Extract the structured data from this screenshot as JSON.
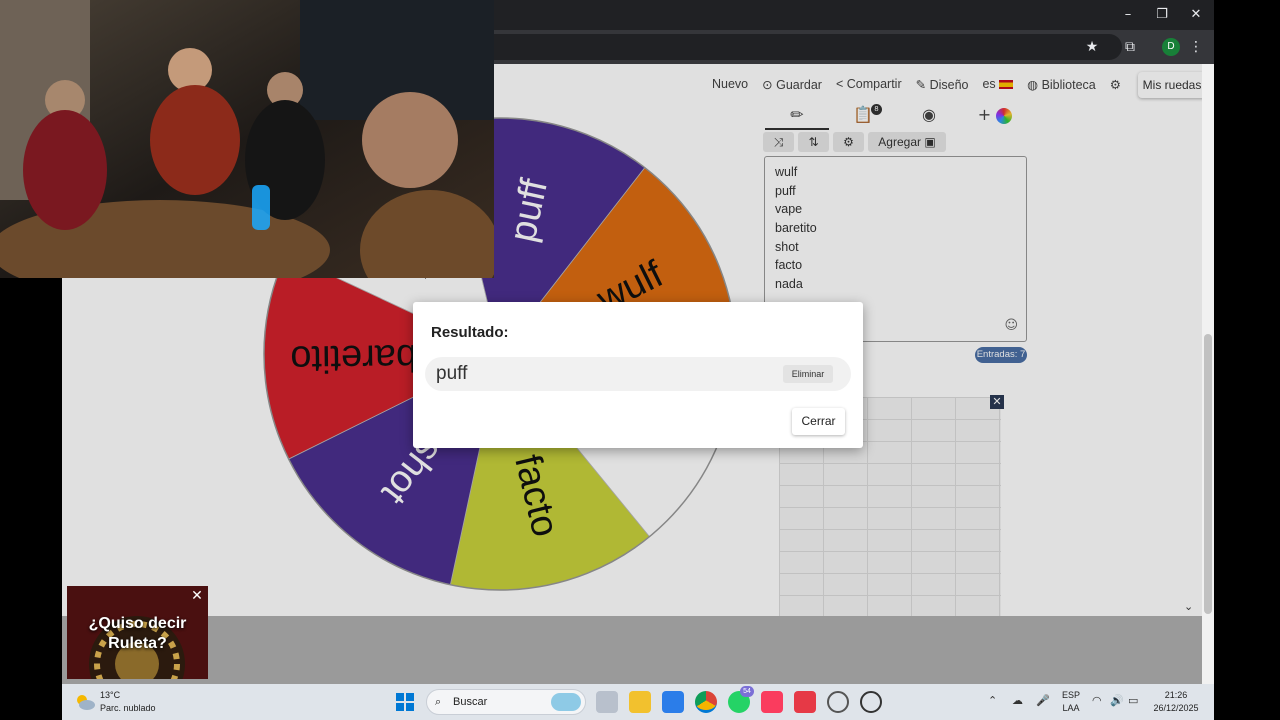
{
  "menu": {
    "items": [
      "Nuevo",
      "Guardar",
      "Compartir",
      "Diseño",
      "es",
      "Biblioteca"
    ],
    "mis_ruedas": "Mis ruedas"
  },
  "panel": {
    "tabs": [
      "pencil-icon",
      "clipboard-icon",
      "eye-off-icon",
      "plus-palette-icon"
    ],
    "clipboard_badge": "8",
    "actions": {
      "agregar": "Agregar"
    },
    "entries": [
      "wulf",
      "puff",
      "vape",
      "baretito",
      "shot",
      "facto",
      "nada"
    ],
    "entries_count": "Entradas: 7"
  },
  "wheel": {
    "segments": [
      {
        "label": "vape",
        "color": "#ffffff"
      },
      {
        "label": "puff",
        "color": "#4b2f8f"
      },
      {
        "label": "wulf",
        "color": "#dd6d12"
      },
      {
        "label": "nada",
        "color": "#ffffff"
      },
      {
        "label": "facto",
        "color": "#c9d23c"
      },
      {
        "label": "shot",
        "color": "#4b2f8f"
      },
      {
        "label": "baretito",
        "color": "#d3212c"
      }
    ]
  },
  "modal": {
    "title": "Resultado:",
    "result": "puff",
    "remove": "Eliminar",
    "close": "Cerrar"
  },
  "ad": {
    "roulette_text": "¿Quiso decir Ruleta?"
  },
  "taskbar": {
    "weather_temp": "13°C",
    "weather_cond": "Parc. nublado",
    "search": "Buscar",
    "lang1": "ESP",
    "lang2": "LAA",
    "time": "21:26",
    "date": "26/12/2025",
    "whatsapp_badge": "54"
  }
}
